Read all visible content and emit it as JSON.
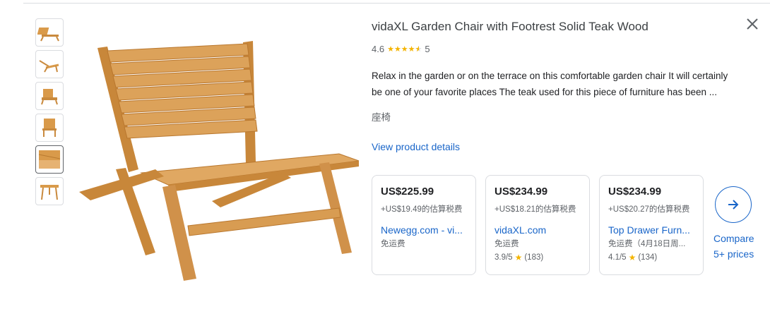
{
  "product": {
    "title": "vidaXL Garden Chair with Footrest Solid Teak Wood",
    "rating": "4.6",
    "stars_icon": "star-icon",
    "review_count": "5",
    "description_line1": "Relax in the garden or on the terrace on this comfortable garden chair It will certainly",
    "description_line2": "be one of your favorite places The teak used for this piece of furniture has been ...",
    "category": "座椅",
    "details_link": "View product details"
  },
  "offers": [
    {
      "price": "US$225.99",
      "tax": "+US$19.49的估算税费",
      "seller": "Newegg.com - vi...",
      "shipping": "免运费",
      "seller_rating": "",
      "seller_reviews": ""
    },
    {
      "price": "US$234.99",
      "tax": "+US$18.21的估算税费",
      "seller": "vidaXL.com",
      "shipping": "免运费",
      "seller_rating": "3.9/5",
      "seller_reviews": "(183)"
    },
    {
      "price": "US$234.99",
      "tax": "+US$20.27的估算税费",
      "seller": "Top Drawer Furn...",
      "shipping": "免运费（4月18日周...",
      "seller_rating": "4.1/5",
      "seller_reviews": "(134)"
    }
  ],
  "compare": {
    "line1": "Compare",
    "line2": "5+ prices"
  },
  "colors": {
    "link": "#1a66c9",
    "star": "#f4b400",
    "wood": "#d99a4a"
  }
}
